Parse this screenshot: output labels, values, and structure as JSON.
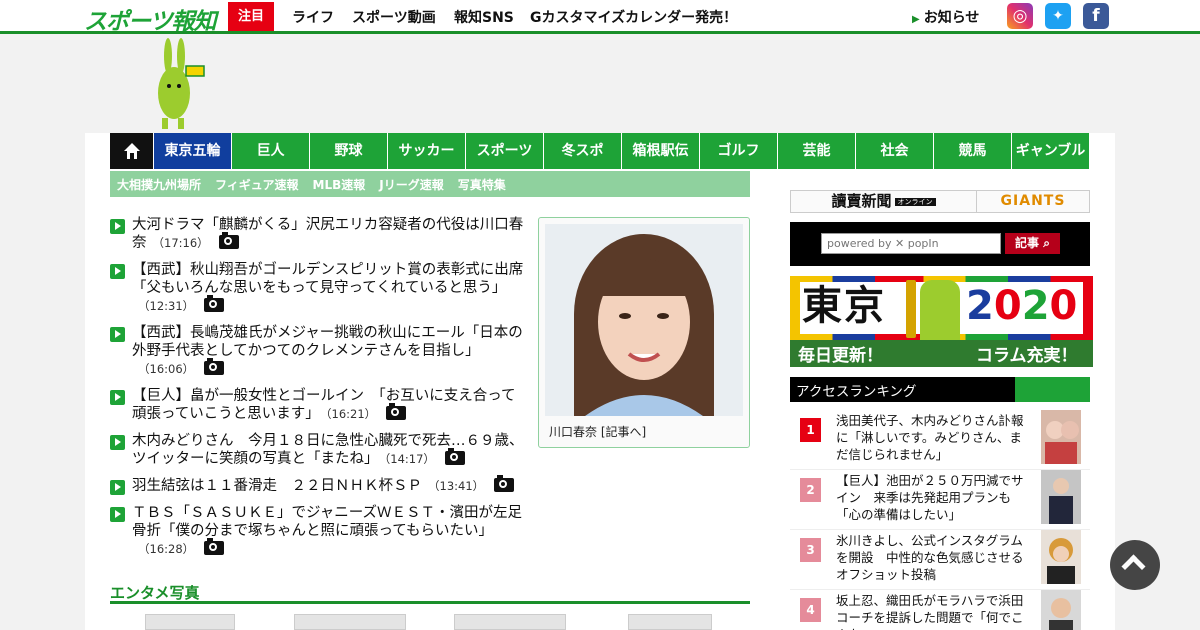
{
  "header": {
    "logo": "スポーツ報知",
    "attention": "注目",
    "nav": [
      "ライフ",
      "スポーツ動画",
      "報知SNS",
      "Gカスタマイズカレンダー発売！"
    ],
    "notice": "お知らせ",
    "sns": {
      "instagram": "instagram-icon",
      "twitter": "twitter-icon",
      "facebook": "facebook-icon"
    }
  },
  "categories": [
    "東京五輪",
    "巨人",
    "野球",
    "サッカー",
    "スポーツ",
    "冬スポ",
    "箱根駅伝",
    "ゴルフ",
    "芸能",
    "社会",
    "競馬",
    "ギャンブル"
  ],
  "subcategories": [
    "大相撲九州場所",
    "フィギュア速報",
    "MLB速報",
    "Jリーグ速報",
    "写真特集"
  ],
  "news": [
    {
      "title": "大河ドラマ「麒麟がくる」沢尻エリカ容疑者の代役は川口春奈",
      "time": "（17:16）"
    },
    {
      "title": "【西武】秋山翔吾がゴールデンスピリット賞の表彰式に出席「父もいろんな思いをもって見守ってくれていると思う」",
      "time": "（12:31）"
    },
    {
      "title": "【西武】長嶋茂雄氏がメジャー挑戦の秋山にエール「日本の外野手代表としてかつてのクレメンテさんを目指し」",
      "time": "（16:06）"
    },
    {
      "title": "【巨人】畠が一般女性とゴールイン　「お互いに支え合って頑張っていこうと思います」",
      "time": "（16:21）"
    },
    {
      "title": "木内みどりさん　今月１８日に急性心臓死で死去…６９歳、ツイッターに笑顔の写真と「またね」",
      "time": "（14:17）"
    },
    {
      "title": "羽生結弦は１１番滑走　２２日ＮＨＫ杯ＳＰ",
      "time": "（13:41）"
    },
    {
      "title": "ＴＢＳ「ＳＡＳＵＫＥ」でジャニーズＷＥＳＴ・濱田が左足骨折「僕の分まで塚ちゃんと照に頑張ってもらいたい」",
      "time": "（16:28）"
    }
  ],
  "feature": {
    "caption": "川口春奈 [記事へ]"
  },
  "entame": {
    "title": "エンタメ写真"
  },
  "sidebar": {
    "yomiuri": "讀賣新聞",
    "yomiuri_badge": "オンライン",
    "giants": "GIANTS",
    "search_placeholder": "powered by ✕ popIn",
    "search_button": "記事",
    "banner": {
      "tokyo": "東京",
      "year": [
        "2",
        "0",
        "2",
        "0"
      ],
      "left": "毎日更新！",
      "right": "コラム充実！"
    },
    "ranking_title": "アクセスランキング",
    "ranking": [
      {
        "num": "1",
        "text": "浅田美代子、木内みどりさん訃報に「淋しいです。みどりさん、まだ信じられません」",
        "color": "#e60012"
      },
      {
        "num": "2",
        "text": "【巨人】池田が２５０万円減でサイン　来季は先発起用プランも「心の準備はしたい」",
        "color": "#e58b9a"
      },
      {
        "num": "3",
        "text": "氷川きよし、公式インスタグラムを開設　中性的な色気感じさせるオフショット投稿",
        "color": "#e58b9a"
      },
      {
        "num": "4",
        "text": "坂上忍、織田氏がモラハラで浜田コーチを提訴した問題で「何でこんな",
        "color": "#e58b9a"
      }
    ]
  },
  "colors": {
    "brand_green": "#1ea337",
    "accent_red": "#e60012",
    "active_blue": "#103e9e"
  }
}
